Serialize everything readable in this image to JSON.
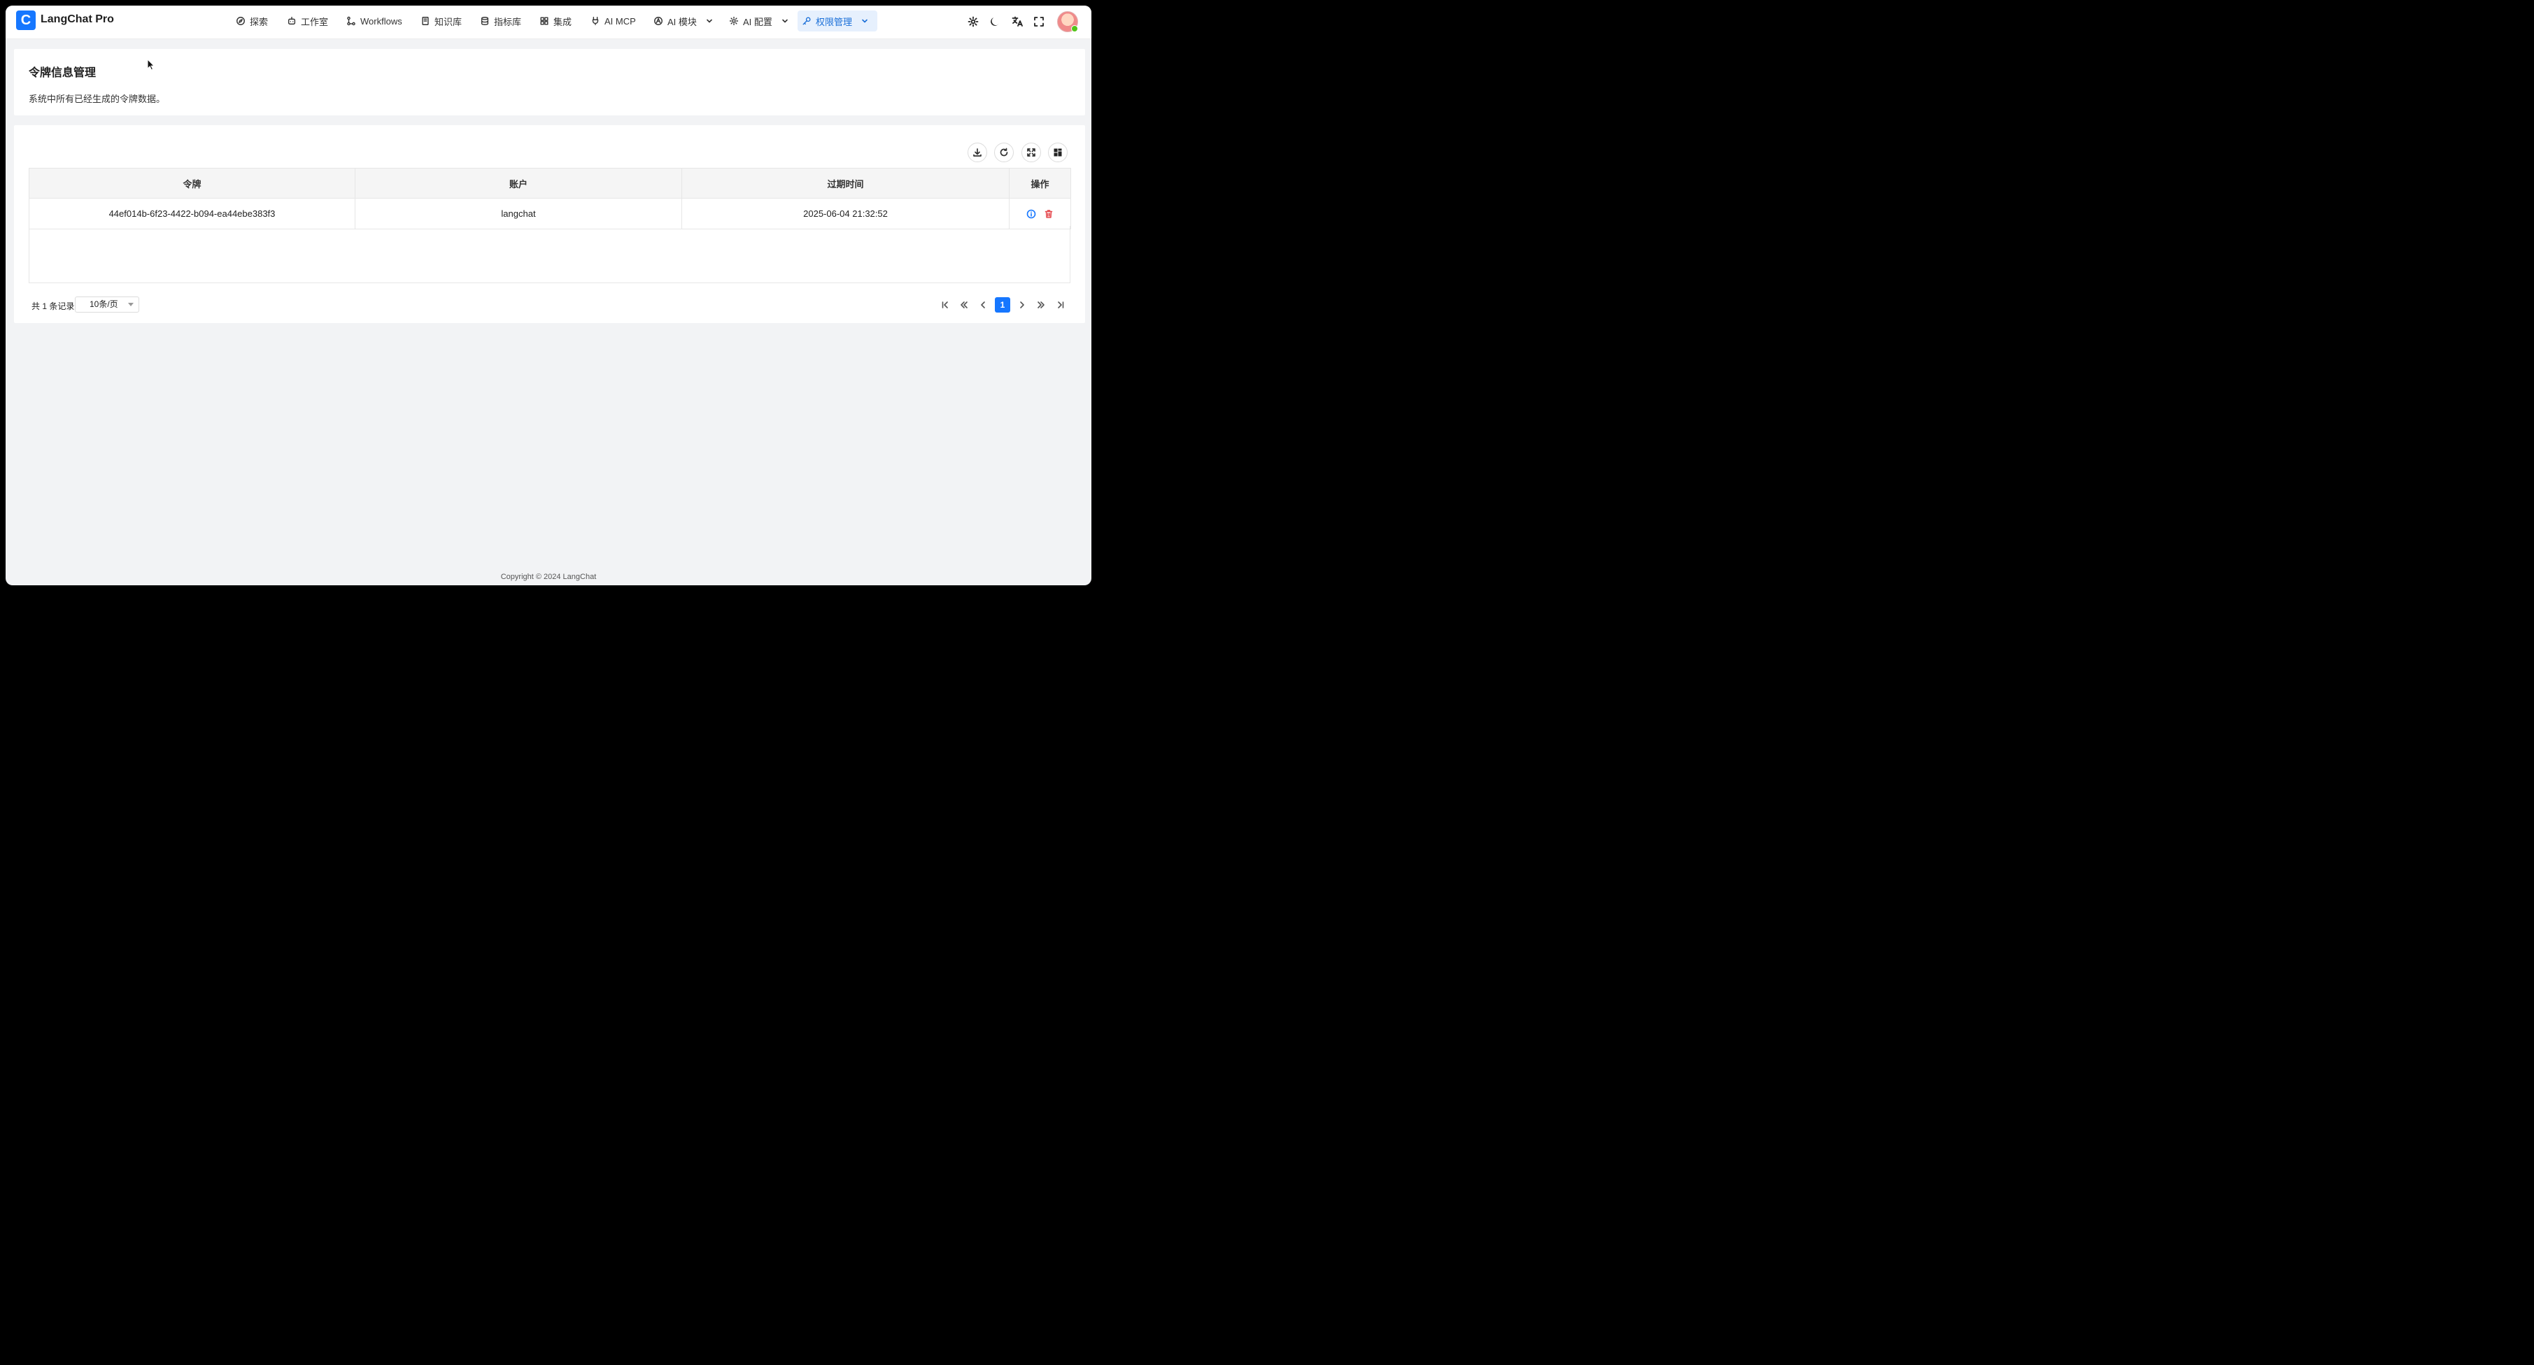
{
  "app": {
    "logo_letter": "C",
    "title": "LangChat Pro"
  },
  "nav": [
    {
      "label": "探索",
      "icon": "compass-icon"
    },
    {
      "label": "工作室",
      "icon": "robot-icon"
    },
    {
      "label": "Workflows",
      "icon": "workflow-icon"
    },
    {
      "label": "知识库",
      "icon": "book-icon"
    },
    {
      "label": "指标库",
      "icon": "database-icon"
    },
    {
      "label": "集成",
      "icon": "grid-plus-icon"
    },
    {
      "label": "AI MCP",
      "icon": "plug-icon"
    },
    {
      "label": "AI 模块",
      "icon": "module-icon"
    },
    {
      "label": "AI 配置",
      "icon": "gear-icon"
    },
    {
      "label": "权限管理",
      "icon": "key-icon"
    }
  ],
  "page": {
    "title": "令牌信息管理",
    "description": "系统中所有已经生成的令牌数据。"
  },
  "table": {
    "columns": [
      "令牌",
      "账户",
      "过期时间",
      "操作"
    ],
    "rows": [
      {
        "token": "44ef014b-6f23-4422-b094-ea44ebe383f3",
        "account": "langchat",
        "expire": "2025-06-04 21:32:52"
      }
    ]
  },
  "pagination": {
    "total_text": "共 1 条记录",
    "page_size": "10条/页",
    "current_page": "1"
  },
  "footer": "Copyright © 2024 LangChat",
  "colors": {
    "primary": "#1677ff",
    "danger": "#e5484d",
    "active_nav_bg": "#e6f0fd"
  }
}
